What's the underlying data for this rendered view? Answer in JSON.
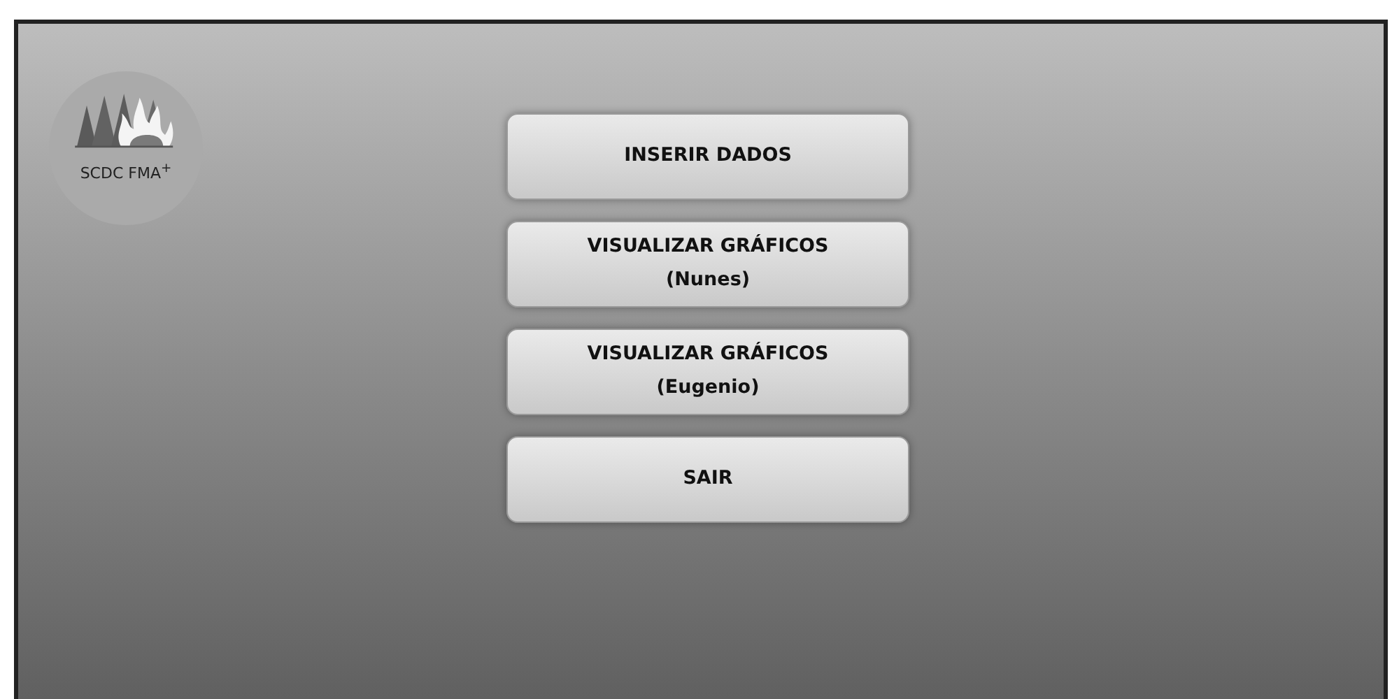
{
  "logo": {
    "caption": "SCDC FMA$^{+}$"
  },
  "menu": [
    {
      "lines": [
        "INSERIR DADOS"
      ]
    },
    {
      "lines": [
        "VISUALIZAR GRÁFICOS",
        "(Nunes)"
      ]
    },
    {
      "lines": [
        "VISUALIZAR GRÁFICOS",
        "(Eugenio)"
      ]
    },
    {
      "lines": [
        "SAIR"
      ]
    }
  ]
}
